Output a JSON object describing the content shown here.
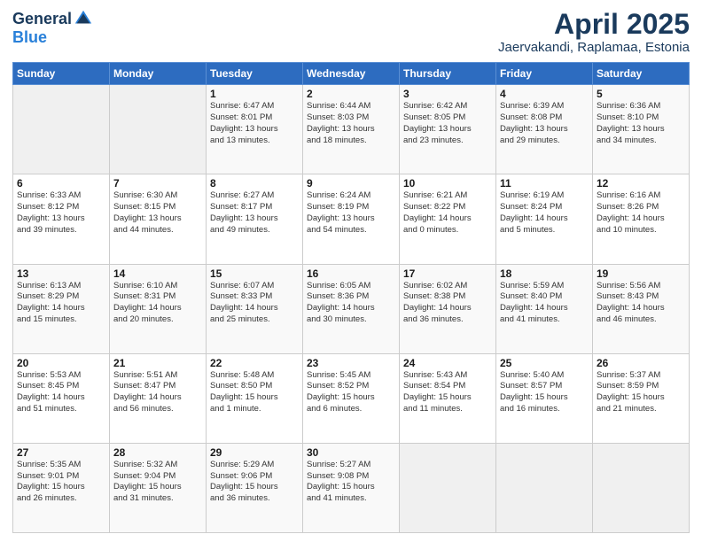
{
  "header": {
    "logo_general": "General",
    "logo_blue": "Blue",
    "title": "April 2025",
    "subtitle": "Jaervakandi, Raplamaa, Estonia"
  },
  "weekdays": [
    "Sunday",
    "Monday",
    "Tuesday",
    "Wednesday",
    "Thursday",
    "Friday",
    "Saturday"
  ],
  "weeks": [
    [
      {
        "day": "",
        "info": ""
      },
      {
        "day": "",
        "info": ""
      },
      {
        "day": "1",
        "info": "Sunrise: 6:47 AM\nSunset: 8:01 PM\nDaylight: 13 hours\nand 13 minutes."
      },
      {
        "day": "2",
        "info": "Sunrise: 6:44 AM\nSunset: 8:03 PM\nDaylight: 13 hours\nand 18 minutes."
      },
      {
        "day": "3",
        "info": "Sunrise: 6:42 AM\nSunset: 8:05 PM\nDaylight: 13 hours\nand 23 minutes."
      },
      {
        "day": "4",
        "info": "Sunrise: 6:39 AM\nSunset: 8:08 PM\nDaylight: 13 hours\nand 29 minutes."
      },
      {
        "day": "5",
        "info": "Sunrise: 6:36 AM\nSunset: 8:10 PM\nDaylight: 13 hours\nand 34 minutes."
      }
    ],
    [
      {
        "day": "6",
        "info": "Sunrise: 6:33 AM\nSunset: 8:12 PM\nDaylight: 13 hours\nand 39 minutes."
      },
      {
        "day": "7",
        "info": "Sunrise: 6:30 AM\nSunset: 8:15 PM\nDaylight: 13 hours\nand 44 minutes."
      },
      {
        "day": "8",
        "info": "Sunrise: 6:27 AM\nSunset: 8:17 PM\nDaylight: 13 hours\nand 49 minutes."
      },
      {
        "day": "9",
        "info": "Sunrise: 6:24 AM\nSunset: 8:19 PM\nDaylight: 13 hours\nand 54 minutes."
      },
      {
        "day": "10",
        "info": "Sunrise: 6:21 AM\nSunset: 8:22 PM\nDaylight: 14 hours\nand 0 minutes."
      },
      {
        "day": "11",
        "info": "Sunrise: 6:19 AM\nSunset: 8:24 PM\nDaylight: 14 hours\nand 5 minutes."
      },
      {
        "day": "12",
        "info": "Sunrise: 6:16 AM\nSunset: 8:26 PM\nDaylight: 14 hours\nand 10 minutes."
      }
    ],
    [
      {
        "day": "13",
        "info": "Sunrise: 6:13 AM\nSunset: 8:29 PM\nDaylight: 14 hours\nand 15 minutes."
      },
      {
        "day": "14",
        "info": "Sunrise: 6:10 AM\nSunset: 8:31 PM\nDaylight: 14 hours\nand 20 minutes."
      },
      {
        "day": "15",
        "info": "Sunrise: 6:07 AM\nSunset: 8:33 PM\nDaylight: 14 hours\nand 25 minutes."
      },
      {
        "day": "16",
        "info": "Sunrise: 6:05 AM\nSunset: 8:36 PM\nDaylight: 14 hours\nand 30 minutes."
      },
      {
        "day": "17",
        "info": "Sunrise: 6:02 AM\nSunset: 8:38 PM\nDaylight: 14 hours\nand 36 minutes."
      },
      {
        "day": "18",
        "info": "Sunrise: 5:59 AM\nSunset: 8:40 PM\nDaylight: 14 hours\nand 41 minutes."
      },
      {
        "day": "19",
        "info": "Sunrise: 5:56 AM\nSunset: 8:43 PM\nDaylight: 14 hours\nand 46 minutes."
      }
    ],
    [
      {
        "day": "20",
        "info": "Sunrise: 5:53 AM\nSunset: 8:45 PM\nDaylight: 14 hours\nand 51 minutes."
      },
      {
        "day": "21",
        "info": "Sunrise: 5:51 AM\nSunset: 8:47 PM\nDaylight: 14 hours\nand 56 minutes."
      },
      {
        "day": "22",
        "info": "Sunrise: 5:48 AM\nSunset: 8:50 PM\nDaylight: 15 hours\nand 1 minute."
      },
      {
        "day": "23",
        "info": "Sunrise: 5:45 AM\nSunset: 8:52 PM\nDaylight: 15 hours\nand 6 minutes."
      },
      {
        "day": "24",
        "info": "Sunrise: 5:43 AM\nSunset: 8:54 PM\nDaylight: 15 hours\nand 11 minutes."
      },
      {
        "day": "25",
        "info": "Sunrise: 5:40 AM\nSunset: 8:57 PM\nDaylight: 15 hours\nand 16 minutes."
      },
      {
        "day": "26",
        "info": "Sunrise: 5:37 AM\nSunset: 8:59 PM\nDaylight: 15 hours\nand 21 minutes."
      }
    ],
    [
      {
        "day": "27",
        "info": "Sunrise: 5:35 AM\nSunset: 9:01 PM\nDaylight: 15 hours\nand 26 minutes."
      },
      {
        "day": "28",
        "info": "Sunrise: 5:32 AM\nSunset: 9:04 PM\nDaylight: 15 hours\nand 31 minutes."
      },
      {
        "day": "29",
        "info": "Sunrise: 5:29 AM\nSunset: 9:06 PM\nDaylight: 15 hours\nand 36 minutes."
      },
      {
        "day": "30",
        "info": "Sunrise: 5:27 AM\nSunset: 9:08 PM\nDaylight: 15 hours\nand 41 minutes."
      },
      {
        "day": "",
        "info": ""
      },
      {
        "day": "",
        "info": ""
      },
      {
        "day": "",
        "info": ""
      }
    ]
  ]
}
